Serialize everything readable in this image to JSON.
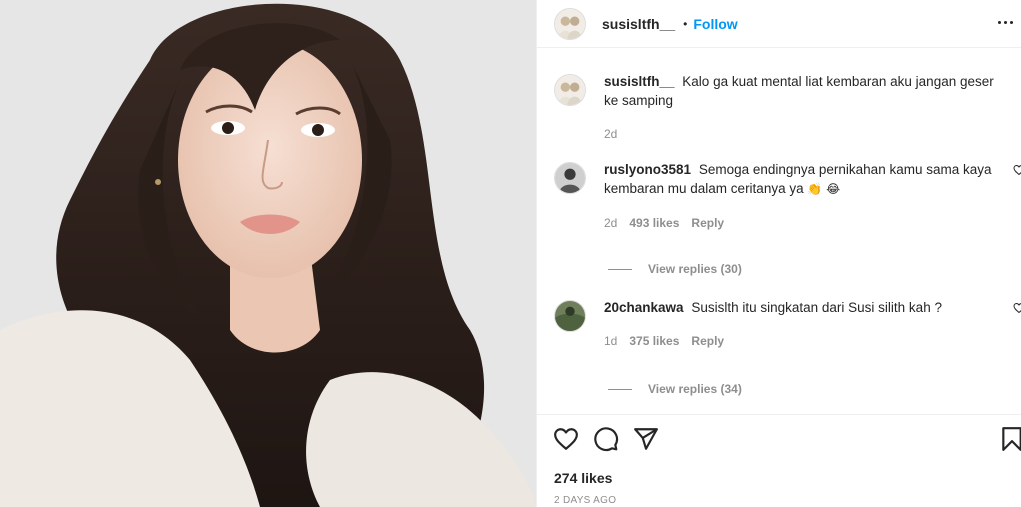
{
  "post": {
    "username": "susisltfh__",
    "dot": "•",
    "follow_label": "Follow"
  },
  "caption": {
    "username": "susisltfh__",
    "text": "Kalo ga kuat mental liat kembaran aku jangan geser ke samping",
    "time": "2d"
  },
  "comments": [
    {
      "username": "ruslyono3581",
      "text": "Semoga endingnya pernikahan kamu sama kaya kembaran mu dalam ceritanya ya",
      "emojis": "👏 😂",
      "time": "2d",
      "likes": "493 likes",
      "reply": "Reply",
      "view_replies": "View replies (30)"
    },
    {
      "username": "20chankawa",
      "text": "Susislth itu singkatan dari Susi silith kah ?",
      "time": "1d",
      "likes": "375 likes",
      "reply": "Reply",
      "view_replies": "View replies (34)"
    }
  ],
  "footer": {
    "likes": "274 likes",
    "date": "2 DAYS AGO"
  },
  "icons": {
    "like": "heart-icon",
    "comment": "comment-icon",
    "share": "share-icon",
    "save": "bookmark-icon",
    "more": "more-icon"
  },
  "colors": {
    "follow": "#0095f6",
    "text": "#262626",
    "muted": "#8e8e8e"
  }
}
